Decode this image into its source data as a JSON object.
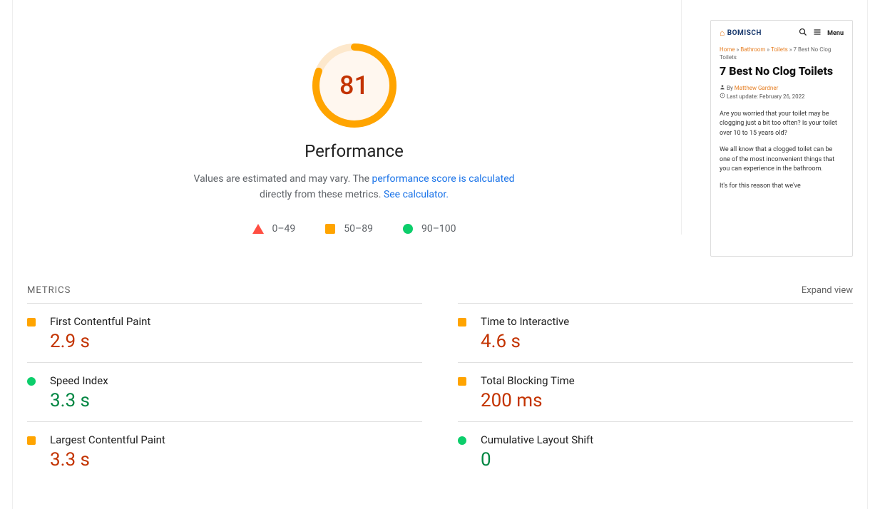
{
  "gauge": {
    "score": "81",
    "title": "Performance",
    "desc_prefix": "Values are estimated and may vary. The ",
    "link1": "performance score is calculated",
    "desc_mid": " directly from these metrics. ",
    "link2": "See calculator."
  },
  "legend": {
    "fail": "0–49",
    "avg": "50–89",
    "pass": "90–100"
  },
  "preview": {
    "logo": "BOMISCH",
    "menu": "Menu",
    "crumb_home": "Home",
    "crumb_bath": "Bathroom",
    "crumb_toilets": "Toilets",
    "crumb_current": "7 Best No Clog Toilets",
    "title": "7 Best No Clog Toilets",
    "by": "By",
    "author": "Matthew Gardner",
    "updated": "Last update: February 26, 2022",
    "p1": "Are you worried that your toilet may be clogging just a bit too often? Is your toilet over 10 to 15 years old?",
    "p2": "We all know that a clogged toilet can be one of the most inconvenient things that you can experience in the bathroom.",
    "p3": "It's for this reason that we've"
  },
  "metrics_header": "METRICS",
  "expand": "Expand view",
  "metrics": {
    "fcp": {
      "label": "First Contentful Paint",
      "value": "2.9 s"
    },
    "tti": {
      "label": "Time to Interactive",
      "value": "4.6 s"
    },
    "si": {
      "label": "Speed Index",
      "value": "3.3 s"
    },
    "tbt": {
      "label": "Total Blocking Time",
      "value": "200 ms"
    },
    "lcp": {
      "label": "Largest Contentful Paint",
      "value": "3.3 s"
    },
    "cls": {
      "label": "Cumulative Layout Shift",
      "value": "0"
    }
  },
  "colors": {
    "avg": "#ffa400",
    "pass": "#0cce6b",
    "fail": "#ff4e42",
    "score_text": "#c33300"
  }
}
